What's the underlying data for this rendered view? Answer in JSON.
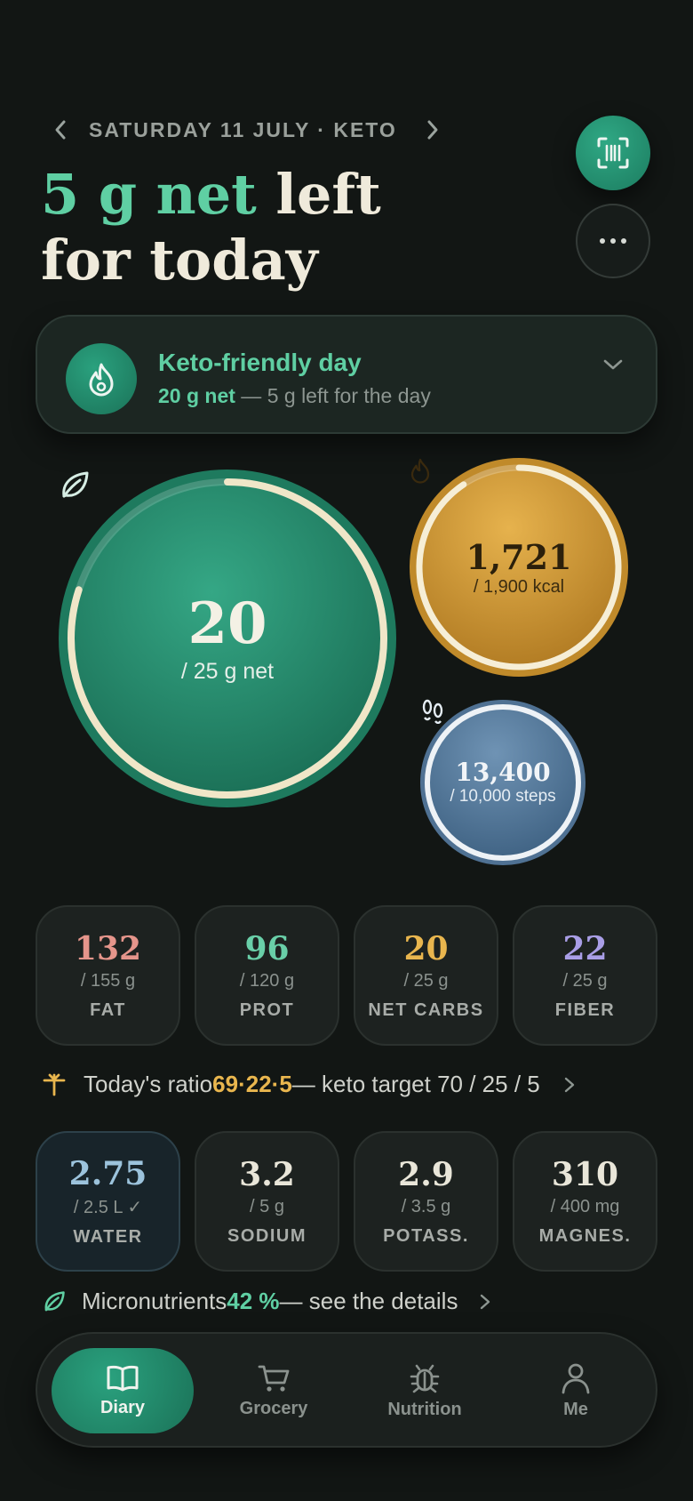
{
  "header": {
    "date_label": "SATURDAY 11 JULY · KETO",
    "headline_accent": "5 g net",
    "headline_rest_1": " left",
    "headline_line_2": "for today",
    "prev_icon": "chevron-left-icon",
    "next_icon": "chevron-right-icon",
    "scan_icon": "barcode-scan-icon",
    "more_icon": "more-dots-icon"
  },
  "keto_banner": {
    "title": "Keto-friendly day",
    "net_value": "20 g net",
    "subtitle_rest": " — 5 g left for the day",
    "icon": "flame-icon"
  },
  "rings": {
    "net_carbs": {
      "value": "20",
      "target": "/ 25 g net",
      "progress": 0.8,
      "icon": "leaf-icon",
      "color": "#2a9a78"
    },
    "calories": {
      "value": "1,721",
      "target": "/ 1,900 kcal",
      "progress": 0.906,
      "icon": "flame-icon",
      "color": "#d5a03a"
    },
    "steps": {
      "value": "13,400",
      "target": "/ 10,000 steps",
      "progress": 1.0,
      "icon": "footprints-icon",
      "color": "#5d82a4"
    }
  },
  "macros": [
    {
      "value": "132",
      "target": "/ 155 g",
      "label": "FAT",
      "color": "#e5958b"
    },
    {
      "value": "96",
      "target": "/ 120 g",
      "label": "PROT",
      "color": "#69cfa8"
    },
    {
      "value": "20",
      "target": "/ 25 g",
      "label": "NET CARBS",
      "color": "#e9b64e"
    },
    {
      "value": "22",
      "target": "/ 25 g",
      "label": "FIBER",
      "color": "#a99ee6"
    }
  ],
  "ratio": {
    "prefix": "Today's ratio ",
    "value": "69·22·5",
    "suffix": " — keto target 70 / 25 / 5",
    "icon": "balance-icon"
  },
  "electrolytes": [
    {
      "value": "2.75",
      "target": "/ 2.5 L ✓",
      "label": "WATER",
      "color": "#9cc3dc"
    },
    {
      "value": "3.2",
      "target": "/ 5 g",
      "label": "SODIUM",
      "color": "#e9e6d9"
    },
    {
      "value": "2.9",
      "target": "/ 3.5 g",
      "label": "POTASS.",
      "color": "#e9e6d9"
    },
    {
      "value": "310",
      "target": "/ 400 mg",
      "label": "MAGNES.",
      "color": "#e9e6d9"
    }
  ],
  "micro": {
    "prefix": "Micronutrients ",
    "value": "42 %",
    "suffix": " — see the details",
    "icon": "leaf-icon"
  },
  "nav": [
    {
      "label": "Diary",
      "icon": "book-icon",
      "active": true
    },
    {
      "label": "Grocery",
      "icon": "cart-icon",
      "active": false
    },
    {
      "label": "Nutrition",
      "icon": "bug-icon",
      "active": false
    },
    {
      "label": "Me",
      "icon": "person-icon",
      "active": false
    }
  ]
}
